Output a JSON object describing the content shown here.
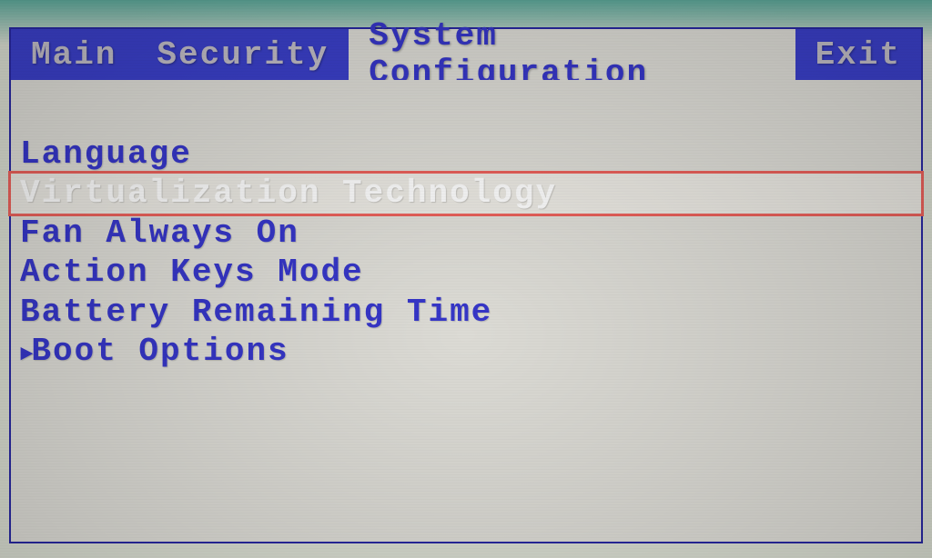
{
  "tabs": {
    "main": "Main",
    "security": "Security",
    "system_config": "System Configuration",
    "exit": "Exit"
  },
  "selected_tab": "system_config",
  "menu": {
    "language": "Language",
    "virtualization": "Virtualization Technology",
    "fan": "Fan Always On",
    "action_keys": "Action Keys Mode",
    "battery": "Battery Remaining Time",
    "boot_options": "Boot Options"
  },
  "highlighted_item": "virtualization"
}
